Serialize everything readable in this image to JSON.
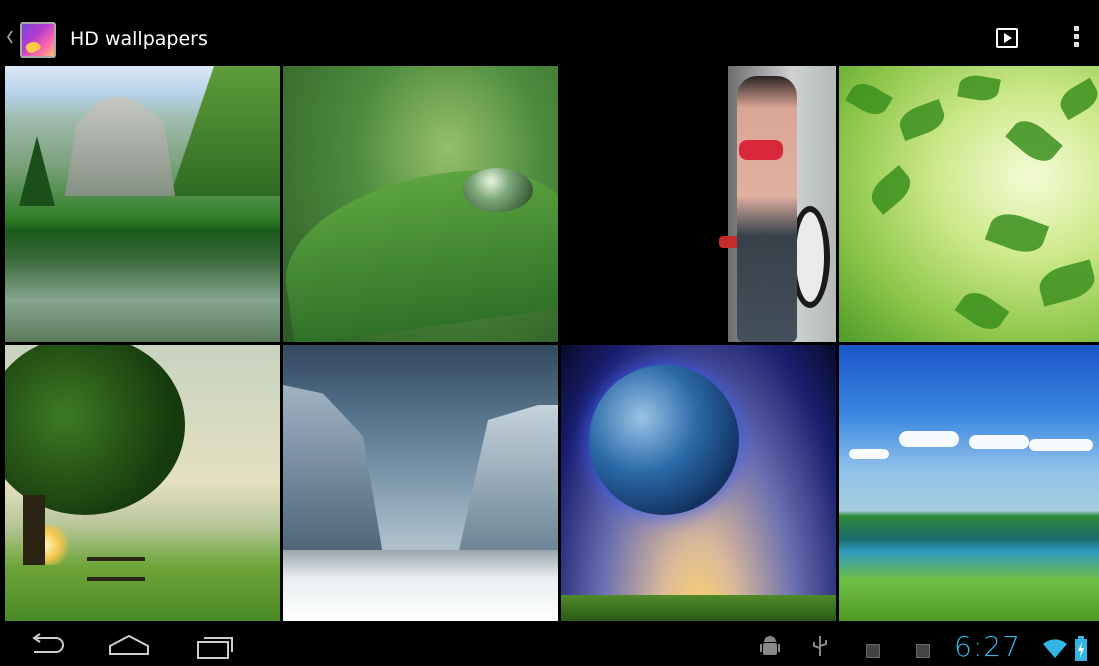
{
  "actionbar": {
    "title": "HD wallpapers",
    "app_icon": "hd-wallpapers-app-icon",
    "actions": [
      "slideshow-icon",
      "overflow-menu-icon"
    ]
  },
  "grid": {
    "tiles": [
      {
        "subject": "waterfall-lake"
      },
      {
        "subject": "water-drop-on-leaf"
      },
      {
        "subject": "woman-red-bikini"
      },
      {
        "subject": "green-leaves"
      },
      {
        "subject": "tree-sunset-bench"
      },
      {
        "subject": "icebergs"
      },
      {
        "subject": "planet-sky"
      },
      {
        "subject": "green-landscape-lake"
      }
    ]
  },
  "navbar": {
    "buttons": [
      "back-icon",
      "home-icon",
      "recent-apps-icon"
    ],
    "status_icons": [
      "android-debug-icon",
      "usb-icon",
      "notification-icon-1",
      "notification-icon-2",
      "wifi-icon",
      "battery-charging-icon"
    ],
    "time": "6:27",
    "accent_color": "#33b5e5"
  }
}
